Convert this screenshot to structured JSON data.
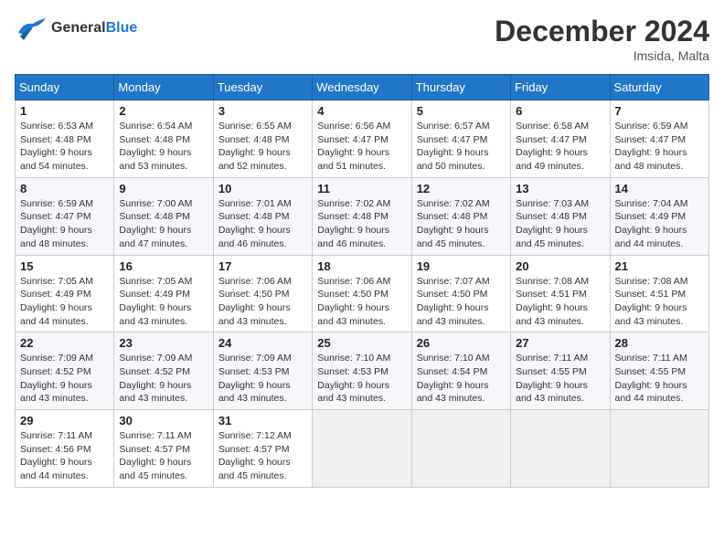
{
  "header": {
    "logo_line1": "General",
    "logo_line2": "Blue",
    "month_title": "December 2024",
    "location": "Imsida, Malta"
  },
  "weekdays": [
    "Sunday",
    "Monday",
    "Tuesday",
    "Wednesday",
    "Thursday",
    "Friday",
    "Saturday"
  ],
  "weeks": [
    [
      {
        "day": "1",
        "sunrise": "Sunrise: 6:53 AM",
        "sunset": "Sunset: 4:48 PM",
        "daylight": "Daylight: 9 hours and 54 minutes."
      },
      {
        "day": "2",
        "sunrise": "Sunrise: 6:54 AM",
        "sunset": "Sunset: 4:48 PM",
        "daylight": "Daylight: 9 hours and 53 minutes."
      },
      {
        "day": "3",
        "sunrise": "Sunrise: 6:55 AM",
        "sunset": "Sunset: 4:48 PM",
        "daylight": "Daylight: 9 hours and 52 minutes."
      },
      {
        "day": "4",
        "sunrise": "Sunrise: 6:56 AM",
        "sunset": "Sunset: 4:47 PM",
        "daylight": "Daylight: 9 hours and 51 minutes."
      },
      {
        "day": "5",
        "sunrise": "Sunrise: 6:57 AM",
        "sunset": "Sunset: 4:47 PM",
        "daylight": "Daylight: 9 hours and 50 minutes."
      },
      {
        "day": "6",
        "sunrise": "Sunrise: 6:58 AM",
        "sunset": "Sunset: 4:47 PM",
        "daylight": "Daylight: 9 hours and 49 minutes."
      },
      {
        "day": "7",
        "sunrise": "Sunrise: 6:59 AM",
        "sunset": "Sunset: 4:47 PM",
        "daylight": "Daylight: 9 hours and 48 minutes."
      }
    ],
    [
      {
        "day": "8",
        "sunrise": "Sunrise: 6:59 AM",
        "sunset": "Sunset: 4:47 PM",
        "daylight": "Daylight: 9 hours and 48 minutes."
      },
      {
        "day": "9",
        "sunrise": "Sunrise: 7:00 AM",
        "sunset": "Sunset: 4:48 PM",
        "daylight": "Daylight: 9 hours and 47 minutes."
      },
      {
        "day": "10",
        "sunrise": "Sunrise: 7:01 AM",
        "sunset": "Sunset: 4:48 PM",
        "daylight": "Daylight: 9 hours and 46 minutes."
      },
      {
        "day": "11",
        "sunrise": "Sunrise: 7:02 AM",
        "sunset": "Sunset: 4:48 PM",
        "daylight": "Daylight: 9 hours and 46 minutes."
      },
      {
        "day": "12",
        "sunrise": "Sunrise: 7:02 AM",
        "sunset": "Sunset: 4:48 PM",
        "daylight": "Daylight: 9 hours and 45 minutes."
      },
      {
        "day": "13",
        "sunrise": "Sunrise: 7:03 AM",
        "sunset": "Sunset: 4:48 PM",
        "daylight": "Daylight: 9 hours and 45 minutes."
      },
      {
        "day": "14",
        "sunrise": "Sunrise: 7:04 AM",
        "sunset": "Sunset: 4:49 PM",
        "daylight": "Daylight: 9 hours and 44 minutes."
      }
    ],
    [
      {
        "day": "15",
        "sunrise": "Sunrise: 7:05 AM",
        "sunset": "Sunset: 4:49 PM",
        "daylight": "Daylight: 9 hours and 44 minutes."
      },
      {
        "day": "16",
        "sunrise": "Sunrise: 7:05 AM",
        "sunset": "Sunset: 4:49 PM",
        "daylight": "Daylight: 9 hours and 43 minutes."
      },
      {
        "day": "17",
        "sunrise": "Sunrise: 7:06 AM",
        "sunset": "Sunset: 4:50 PM",
        "daylight": "Daylight: 9 hours and 43 minutes."
      },
      {
        "day": "18",
        "sunrise": "Sunrise: 7:06 AM",
        "sunset": "Sunset: 4:50 PM",
        "daylight": "Daylight: 9 hours and 43 minutes."
      },
      {
        "day": "19",
        "sunrise": "Sunrise: 7:07 AM",
        "sunset": "Sunset: 4:50 PM",
        "daylight": "Daylight: 9 hours and 43 minutes."
      },
      {
        "day": "20",
        "sunrise": "Sunrise: 7:08 AM",
        "sunset": "Sunset: 4:51 PM",
        "daylight": "Daylight: 9 hours and 43 minutes."
      },
      {
        "day": "21",
        "sunrise": "Sunrise: 7:08 AM",
        "sunset": "Sunset: 4:51 PM",
        "daylight": "Daylight: 9 hours and 43 minutes."
      }
    ],
    [
      {
        "day": "22",
        "sunrise": "Sunrise: 7:09 AM",
        "sunset": "Sunset: 4:52 PM",
        "daylight": "Daylight: 9 hours and 43 minutes."
      },
      {
        "day": "23",
        "sunrise": "Sunrise: 7:09 AM",
        "sunset": "Sunset: 4:52 PM",
        "daylight": "Daylight: 9 hours and 43 minutes."
      },
      {
        "day": "24",
        "sunrise": "Sunrise: 7:09 AM",
        "sunset": "Sunset: 4:53 PM",
        "daylight": "Daylight: 9 hours and 43 minutes."
      },
      {
        "day": "25",
        "sunrise": "Sunrise: 7:10 AM",
        "sunset": "Sunset: 4:53 PM",
        "daylight": "Daylight: 9 hours and 43 minutes."
      },
      {
        "day": "26",
        "sunrise": "Sunrise: 7:10 AM",
        "sunset": "Sunset: 4:54 PM",
        "daylight": "Daylight: 9 hours and 43 minutes."
      },
      {
        "day": "27",
        "sunrise": "Sunrise: 7:11 AM",
        "sunset": "Sunset: 4:55 PM",
        "daylight": "Daylight: 9 hours and 43 minutes."
      },
      {
        "day": "28",
        "sunrise": "Sunrise: 7:11 AM",
        "sunset": "Sunset: 4:55 PM",
        "daylight": "Daylight: 9 hours and 44 minutes."
      }
    ],
    [
      {
        "day": "29",
        "sunrise": "Sunrise: 7:11 AM",
        "sunset": "Sunset: 4:56 PM",
        "daylight": "Daylight: 9 hours and 44 minutes."
      },
      {
        "day": "30",
        "sunrise": "Sunrise: 7:11 AM",
        "sunset": "Sunset: 4:57 PM",
        "daylight": "Daylight: 9 hours and 45 minutes."
      },
      {
        "day": "31",
        "sunrise": "Sunrise: 7:12 AM",
        "sunset": "Sunset: 4:57 PM",
        "daylight": "Daylight: 9 hours and 45 minutes."
      },
      null,
      null,
      null,
      null
    ]
  ]
}
